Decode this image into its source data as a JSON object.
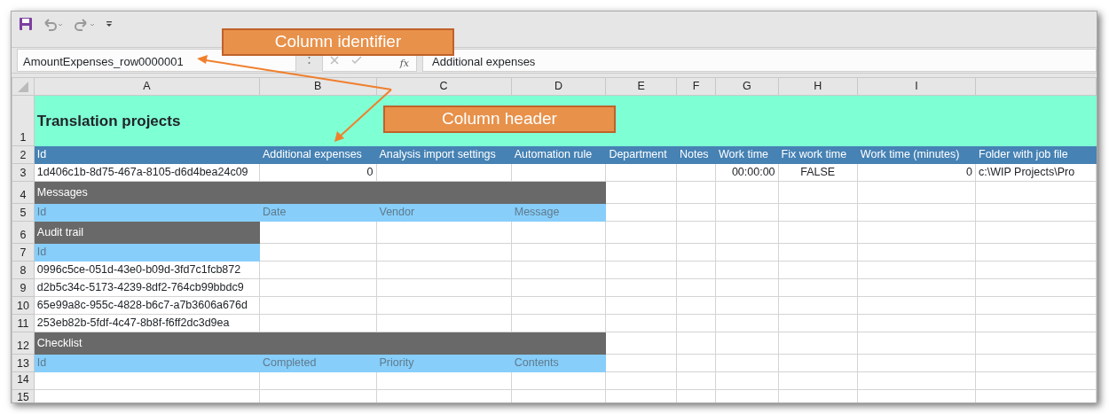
{
  "formula_bar": {
    "name_box": "AmountExpenses_row0000001",
    "function_label": "fx",
    "formula": "Additional expenses"
  },
  "columns": [
    "A",
    "B",
    "C",
    "D",
    "E",
    "F",
    "G",
    "H",
    "I"
  ],
  "rows": [
    {
      "number": "1",
      "kind": "title",
      "text": "Translation projects"
    },
    {
      "number": "2",
      "kind": "header",
      "cells": [
        "Id",
        "Additional expenses",
        "Analysis import settings",
        "Automation rule",
        "Department",
        "Notes",
        "Work time",
        "Fix work time",
        "Work time (minutes)",
        "Folder with job file"
      ]
    },
    {
      "number": "3",
      "kind": "data",
      "cells": [
        {
          "text": "1d406c1b-8d75-467a-8105-d6d4bea24c09",
          "kind": "text"
        },
        {
          "text": "0",
          "kind": "number"
        },
        null,
        null,
        null,
        null,
        {
          "text": "00:00:00",
          "kind": "number"
        },
        {
          "text": "FALSE",
          "kind": "boolean"
        },
        {
          "text": "0",
          "kind": "number"
        },
        {
          "text": "c:\\WIP Projects\\Pro",
          "kind": "text"
        }
      ]
    },
    {
      "number": "4",
      "kind": "section",
      "text": "Messages",
      "spans_table": true
    },
    {
      "number": "5",
      "kind": "subheader",
      "cells": [
        "Id",
        "Date",
        "Vendor",
        "Message"
      ]
    },
    {
      "number": "6",
      "kind": "section",
      "text": "Audit trail",
      "spans_table": false
    },
    {
      "number": "7",
      "kind": "subheader",
      "cells": [
        "Id"
      ]
    },
    {
      "number": "8",
      "kind": "data",
      "cells": [
        {
          "text": "0996c5ce-051d-43e0-b09d-3fd7c1fcb872",
          "kind": "text"
        }
      ]
    },
    {
      "number": "9",
      "kind": "data",
      "cells": [
        {
          "text": "d2b5c34c-5173-4239-8df2-764cb99bbdc9",
          "kind": "text"
        }
      ]
    },
    {
      "number": "10",
      "kind": "data",
      "cells": [
        {
          "text": "65e99a8c-955c-4828-b6c7-a7b3606a676d",
          "kind": "text"
        }
      ]
    },
    {
      "number": "11",
      "kind": "data",
      "cells": [
        {
          "text": "253eb82b-5fdf-4c47-8b8f-f6ff2dc3d9ea",
          "kind": "text"
        }
      ]
    },
    {
      "number": "12",
      "kind": "section",
      "text": "Checklist",
      "spans_table": true
    },
    {
      "number": "13",
      "kind": "subheader",
      "cells": [
        "Id",
        "Completed",
        "Priority",
        "Contents"
      ]
    },
    {
      "number": "14",
      "kind": "blank"
    },
    {
      "number": "15",
      "kind": "blank"
    }
  ],
  "callouts": [
    {
      "text": "Column identifier"
    },
    {
      "text": "Column header"
    }
  ]
}
